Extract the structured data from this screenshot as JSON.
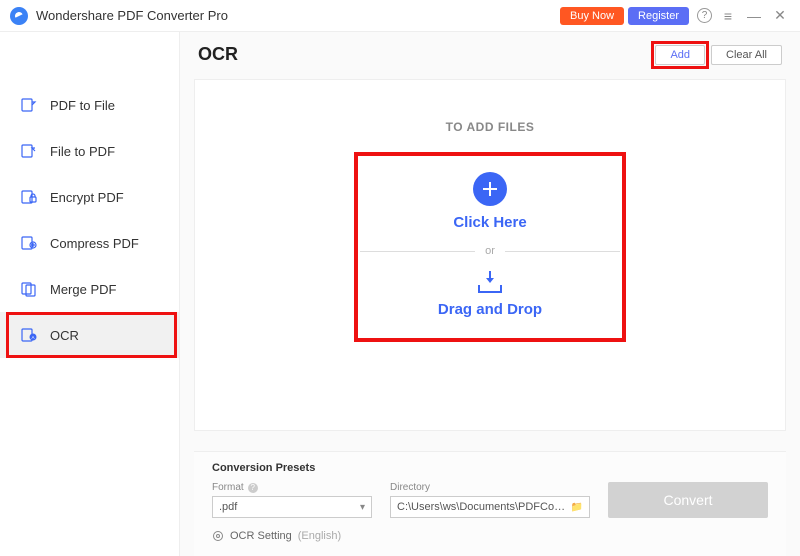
{
  "titlebar": {
    "app_title": "Wondershare PDF Converter Pro",
    "buy_label": "Buy Now",
    "register_label": "Register",
    "help_symbol": "?",
    "menu_symbol": "≡",
    "min_symbol": "—",
    "close_symbol": "✕"
  },
  "sidebar": {
    "items": [
      {
        "label": "PDF to File"
      },
      {
        "label": "File to PDF"
      },
      {
        "label": "Encrypt PDF"
      },
      {
        "label": "Compress PDF"
      },
      {
        "label": "Merge PDF"
      },
      {
        "label": "OCR"
      }
    ]
  },
  "main": {
    "title": "OCR",
    "add_label": "Add",
    "clear_label": "Clear All",
    "to_add_label": "TO ADD FILES",
    "click_here": "Click Here",
    "or": "or",
    "drag_drop": "Drag and Drop"
  },
  "presets": {
    "title": "Conversion Presets",
    "format_label": "Format",
    "format_value": ".pdf",
    "directory_label": "Directory",
    "directory_value": "C:\\Users\\ws\\Documents\\PDFConvert",
    "ocr_setting": "OCR Setting",
    "ocr_lang": "(English)",
    "convert_label": "Convert"
  }
}
